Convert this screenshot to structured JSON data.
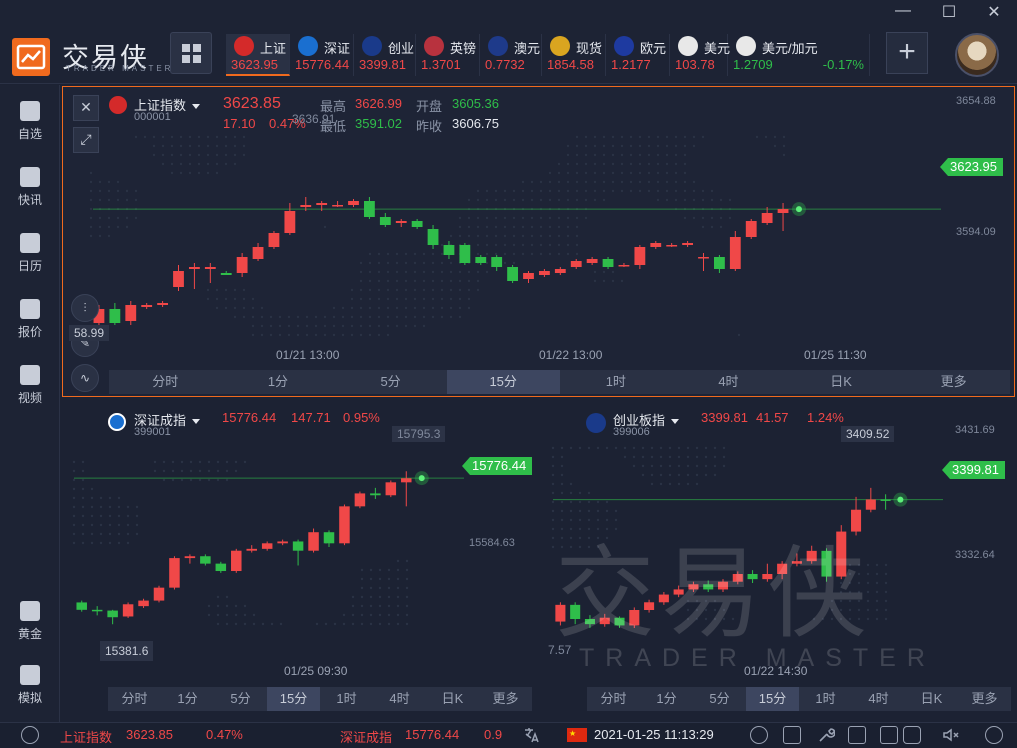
{
  "app": {
    "brand": "交易侠",
    "brand_sub": "TRADER MASTER"
  },
  "window": {
    "minimize": "—",
    "maximize": "☐",
    "close": "✕"
  },
  "tickers": [
    {
      "name": "上证",
      "value": "3623.95",
      "value_color": "red",
      "icon": "sse-logo-icon",
      "icon_color": "#d42a2a"
    },
    {
      "name": "深证",
      "value": "15776.44",
      "value_color": "red",
      "icon": "szse-logo-icon",
      "icon_color": "#1a6fd0"
    },
    {
      "name": "创业",
      "value": "3399.81",
      "value_color": "red",
      "icon": "chinext-logo-icon",
      "icon_color": "#1a3a8a"
    },
    {
      "name": "英镑",
      "value": "1.3701",
      "value_color": "red",
      "icon": "uk-flag-icon",
      "icon_color": "#b8323e"
    },
    {
      "name": "澳元",
      "value": "0.7732",
      "value_color": "red",
      "icon": "au-flag-icon",
      "icon_color": "#1e3a8a"
    },
    {
      "name": "现货",
      "value": "1854.58",
      "value_color": "red",
      "icon": "gold-icon",
      "icon_color": "#d9a520"
    },
    {
      "name": "欧元",
      "value": "1.2177",
      "value_color": "red",
      "icon": "eu-flag-icon",
      "icon_color": "#1e3aa0"
    },
    {
      "name": "美元",
      "value": "103.78",
      "value_color": "red",
      "icon": "jp-flag-icon",
      "icon_color": "#e8e8e8"
    },
    {
      "name": "美元/加元",
      "value": "1.2709",
      "change": "-0.17%",
      "value_color": "green",
      "icon": "ca-flag-icon",
      "icon_color": "#e8e8e8"
    }
  ],
  "sidebar": [
    {
      "label": "自选",
      "icon": "favorite-add-icon"
    },
    {
      "label": "快讯",
      "icon": "news-icon"
    },
    {
      "label": "日历",
      "icon": "calendar-icon"
    },
    {
      "label": "报价",
      "icon": "quote-chart-icon"
    },
    {
      "label": "视频",
      "icon": "video-play-icon"
    },
    {
      "label": "黄金",
      "icon": "gold-bars-icon"
    },
    {
      "label": "模拟",
      "icon": "simulation-wallet-icon"
    }
  ],
  "main_chart": {
    "name": "上证指数",
    "code": "000001",
    "price": "3623.85",
    "change": "17.10",
    "change_pct": "0.47%",
    "high_label": "最高",
    "high": "3626.99",
    "open_label": "开盘",
    "open": "3605.36",
    "low_label": "最低",
    "low": "3591.02",
    "prev_label": "昨收",
    "prev_close": "3606.75",
    "current_tag": "3623.95",
    "hi_marker": "3636.91",
    "lo_marker": "58.99",
    "y_ticks": [
      "3654.88",
      "3594.09"
    ],
    "x_ticks": [
      "01/21 13:00",
      "01/22 13:00",
      "01/25 11:30"
    ]
  },
  "sz_chart": {
    "name": "深证成指",
    "code": "399001",
    "price": "15776.44",
    "change": "147.71",
    "change_pct": "0.95%",
    "current_tag": "15776.44",
    "hi_marker": "15795.3",
    "lo_marker": "15381.6",
    "y_ticks": [
      "15584.63"
    ],
    "x_ticks": [
      "01/25 09:30"
    ]
  },
  "cy_chart": {
    "name": "创业板指",
    "code": "399006",
    "price": "3399.81",
    "change": "41.57",
    "change_pct": "1.24%",
    "current_tag": "3399.81",
    "hi_marker": "3409.52",
    "lo_marker": "7.57",
    "y_ticks": [
      "3431.69",
      "3332.64"
    ],
    "x_ticks": [
      "01/22 14:30"
    ]
  },
  "periods": [
    "分时",
    "1分",
    "5分",
    "15分",
    "1时",
    "4时",
    "日K",
    "更多"
  ],
  "active_period": "15分",
  "watermark": {
    "cn": "交易侠",
    "en": "TRADER MASTER"
  },
  "status": {
    "idx1_name": "上证指数",
    "idx1_value": "3623.85",
    "idx1_pct": "0.47%",
    "idx2_name": "深证成指",
    "idx2_value": "15776.44",
    "idx2_pct": "0.9",
    "datetime": "2021-01-25 11:13:29"
  },
  "chart_data": [
    {
      "type": "candlestick",
      "title": "上证指数 15分",
      "ylim": [
        3560,
        3660
      ],
      "current": 3623.95,
      "candles": [
        [
          3567,
          3574,
          3563,
          3576
        ],
        [
          3574,
          3567,
          3566,
          3577
        ],
        [
          3568,
          3576,
          3566,
          3578
        ],
        [
          3575,
          3576,
          3574,
          3577
        ],
        [
          3576,
          3577,
          3575,
          3578
        ],
        [
          3585,
          3593,
          3583,
          3596
        ],
        [
          3594,
          3595,
          3584,
          3597
        ],
        [
          3594,
          3595,
          3587,
          3597
        ],
        [
          3592,
          3591,
          3592,
          3593
        ],
        [
          3592,
          3600,
          3590,
          3602
        ],
        [
          3599,
          3605,
          3598,
          3607
        ],
        [
          3605,
          3612,
          3604,
          3613
        ],
        [
          3612,
          3623,
          3611,
          3627
        ],
        [
          3625,
          3626,
          3623,
          3630
        ],
        [
          3626,
          3627,
          3623,
          3628
        ],
        [
          3626,
          3626,
          3625,
          3628
        ],
        [
          3626,
          3628,
          3625,
          3629
        ],
        [
          3628,
          3620,
          3619,
          3630
        ],
        [
          3620,
          3616,
          3615,
          3622
        ],
        [
          3617,
          3618,
          3615,
          3619
        ],
        [
          3618,
          3615,
          3614,
          3619
        ],
        [
          3614,
          3606,
          3604,
          3616
        ],
        [
          3606,
          3601,
          3599,
          3608
        ],
        [
          3606,
          3597,
          3596,
          3607
        ],
        [
          3600,
          3597,
          3596,
          3601
        ],
        [
          3600,
          3595,
          3593,
          3601
        ],
        [
          3595,
          3588,
          3587,
          3596
        ],
        [
          3589,
          3592,
          3587,
          3593
        ],
        [
          3591,
          3593,
          3590,
          3594
        ],
        [
          3592,
          3594,
          3591,
          3595
        ],
        [
          3595,
          3598,
          3594,
          3599
        ],
        [
          3597,
          3599,
          3596,
          3600
        ],
        [
          3599,
          3595,
          3594,
          3600
        ],
        [
          3596,
          3596,
          3595,
          3597
        ],
        [
          3596,
          3605,
          3594,
          3606
        ],
        [
          3605,
          3607,
          3604,
          3608
        ],
        [
          3606,
          3606,
          3605,
          3607
        ],
        [
          3606,
          3607,
          3605,
          3608
        ],
        [
          3600,
          3600,
          3593,
          3602
        ],
        [
          3600,
          3594,
          3592,
          3601
        ],
        [
          3594,
          3610,
          3593,
          3613
        ],
        [
          3610,
          3618,
          3609,
          3619
        ],
        [
          3617,
          3622,
          3616,
          3625
        ],
        [
          3622,
          3624,
          3613,
          3627
        ]
      ]
    },
    {
      "type": "candlestick",
      "title": "深证成指 15分",
      "ylim": [
        15360,
        15820
      ],
      "current": 15776.44,
      "candles": [
        [
          15440,
          15420,
          15415,
          15445
        ],
        [
          15420,
          15418,
          15405,
          15430
        ],
        [
          15418,
          15400,
          15381,
          15420
        ],
        [
          15402,
          15435,
          15398,
          15440
        ],
        [
          15430,
          15445,
          15425,
          15450
        ],
        [
          15445,
          15480,
          15440,
          15485
        ],
        [
          15480,
          15560,
          15475,
          15565
        ],
        [
          15560,
          15565,
          15545,
          15570
        ],
        [
          15565,
          15545,
          15540,
          15570
        ],
        [
          15545,
          15525,
          15520,
          15550
        ],
        [
          15525,
          15580,
          15520,
          15585
        ],
        [
          15580,
          15585,
          15575,
          15595
        ],
        [
          15585,
          15600,
          15580,
          15605
        ],
        [
          15600,
          15605,
          15595,
          15610
        ],
        [
          15605,
          15580,
          15540,
          15610
        ],
        [
          15580,
          15630,
          15575,
          15640
        ],
        [
          15630,
          15600,
          15590,
          15635
        ],
        [
          15600,
          15700,
          15595,
          15705
        ],
        [
          15700,
          15735,
          15695,
          15740
        ],
        [
          15735,
          15730,
          15720,
          15750
        ],
        [
          15730,
          15765,
          15725,
          15770
        ],
        [
          15765,
          15776,
          15700,
          15795
        ]
      ]
    },
    {
      "type": "candlestick",
      "title": "创业板指 15分",
      "ylim": [
        3300,
        3440
      ],
      "current": 3399.81,
      "candles": [
        [
          3305,
          3318,
          3302,
          3320
        ],
        [
          3318,
          3307,
          3303,
          3320
        ],
        [
          3307,
          3303,
          3300,
          3310
        ],
        [
          3303,
          3308,
          3301,
          3311
        ],
        [
          3308,
          3302,
          3300,
          3309
        ],
        [
          3302,
          3314,
          3300,
          3316
        ],
        [
          3314,
          3320,
          3312,
          3322
        ],
        [
          3320,
          3326,
          3318,
          3328
        ],
        [
          3326,
          3330,
          3324,
          3333
        ],
        [
          3330,
          3334,
          3328,
          3336
        ],
        [
          3334,
          3330,
          3328,
          3337
        ],
        [
          3330,
          3336,
          3328,
          3338
        ],
        [
          3336,
          3342,
          3334,
          3344
        ],
        [
          3342,
          3338,
          3335,
          3345
        ],
        [
          3338,
          3342,
          3336,
          3350
        ],
        [
          3342,
          3350,
          3338,
          3352
        ],
        [
          3350,
          3352,
          3348,
          3358
        ],
        [
          3352,
          3360,
          3350,
          3364
        ],
        [
          3360,
          3340,
          3336,
          3362
        ],
        [
          3340,
          3375,
          3338,
          3380
        ],
        [
          3375,
          3392,
          3372,
          3402
        ],
        [
          3392,
          3400,
          3390,
          3409
        ],
        [
          3400,
          3399,
          3392,
          3404
        ]
      ]
    }
  ],
  "colors": {
    "up": "#f04848",
    "down": "#2fbe4a",
    "accent": "#f06a1e",
    "bg": "#1c2233",
    "panel": "#2a3144"
  }
}
